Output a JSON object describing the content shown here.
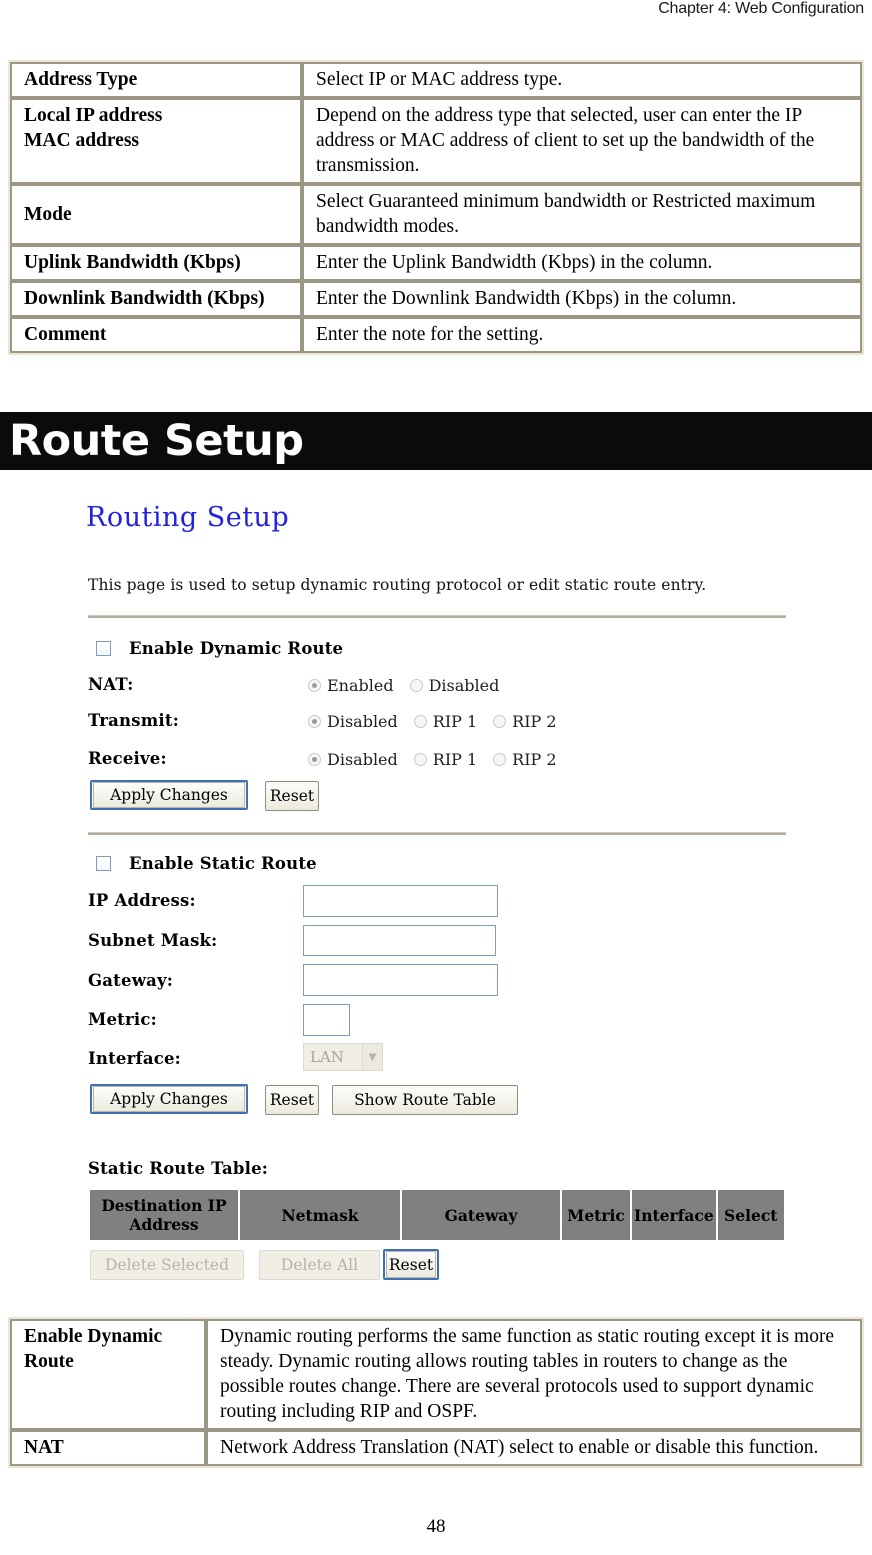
{
  "page": {
    "running_header": "Chapter 4: Web Configuration",
    "page_number": "48"
  },
  "top_table": {
    "rows": [
      {
        "key": "Address Type",
        "value": "Select IP or MAC address type."
      },
      {
        "key": "Local IP address\nMAC address",
        "value": "Depend on the address type that selected, user can enter the IP address or MAC address of client to set up the bandwidth of the transmission."
      },
      {
        "key": "Mode",
        "value": "Select Guaranteed minimum bandwidth or Restricted maximum bandwidth modes."
      },
      {
        "key": "Uplink Bandwidth (Kbps)",
        "value": "Enter the Uplink Bandwidth (Kbps) in the column."
      },
      {
        "key": "Downlink Bandwidth (Kbps)",
        "value": "Enter the Downlink Bandwidth (Kbps) in the column."
      },
      {
        "key": "Comment",
        "value": "Enter the note for the setting."
      }
    ]
  },
  "section_banner": {
    "title": "Route Setup"
  },
  "screenshot": {
    "title": "Routing Setup",
    "intro": "This page is used to setup dynamic routing protocol or edit static route entry.",
    "dynamic": {
      "enable_label": "Enable Dynamic Route",
      "enable_checked": false,
      "nat_label": "NAT:",
      "nat_options": [
        "Enabled",
        "Disabled"
      ],
      "nat_selected": "Enabled",
      "transmit_label": "Transmit:",
      "transmit_options": [
        "Disabled",
        "RIP 1",
        "RIP 2"
      ],
      "transmit_selected": "Disabled",
      "receive_label": "Receive:",
      "receive_options": [
        "Disabled",
        "RIP 1",
        "RIP 2"
      ],
      "receive_selected": "Disabled",
      "apply_label": "Apply Changes",
      "reset_label": "Reset"
    },
    "static": {
      "enable_label": "Enable Static Route",
      "enable_checked": false,
      "ip_address_label": "IP Address:",
      "ip_address_value": "",
      "subnet_mask_label": "Subnet Mask:",
      "subnet_mask_value": "",
      "gateway_label": "Gateway:",
      "gateway_value": "",
      "metric_label": "Metric:",
      "metric_value": "",
      "interface_label": "Interface:",
      "interface_value": "LAN",
      "interface_options": [
        "LAN"
      ],
      "apply_label": "Apply Changes",
      "reset_label": "Reset",
      "show_route_table_label": "Show Route Table"
    },
    "route_table": {
      "caption": "Static Route Table:",
      "columns": [
        "Destination IP Address",
        "Netmask",
        "Gateway",
        "Metric",
        "Interface",
        "Select"
      ],
      "rows": [],
      "delete_selected_label": "Delete Selected",
      "delete_all_label": "Delete All",
      "reset_label": "Reset"
    }
  },
  "bottom_table": {
    "rows": [
      {
        "key": "Enable Dynamic Route",
        "value": "Dynamic routing performs the same function as static routing except it is more steady. Dynamic routing allows routing tables in routers to change as the possible routes change. There are several protocols used to support dynamic routing including RIP and OSPF."
      },
      {
        "key": "NAT",
        "value": "Network Address Translation (NAT) select to enable or disable this function."
      }
    ]
  },
  "colors": {
    "banner_bg": "#0b0b0b",
    "screenshot_title": "#2222dd",
    "table_header_bg": "#808080",
    "table_outer_border": "#ebe6d4",
    "table_cell_border": "#9c9684"
  }
}
